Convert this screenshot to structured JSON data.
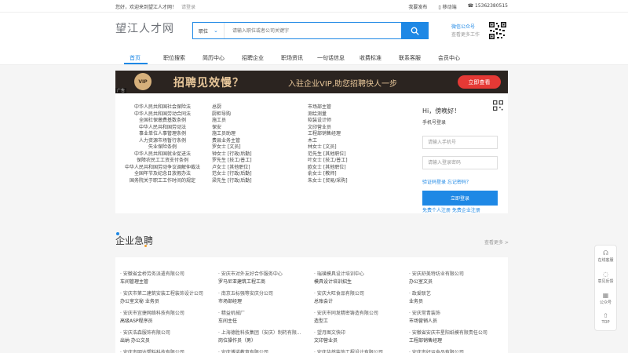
{
  "topbar": {
    "greeting": "您好，欢迎来到望江人才网！",
    "login": "请登录",
    "post_job": "我要发布",
    "mobile": "移动端",
    "phone": "15362380515"
  },
  "header": {
    "logo": "望江人才网",
    "search_category": "职位",
    "search_placeholder": "请输入职位或者公司关键字",
    "wechat_title": "微信公众号",
    "wechat_sub": "查看更多工作"
  },
  "nav": [
    "首页",
    "职位搜索",
    "简历中心",
    "招聘企业",
    "职场资讯",
    "一句话信息",
    "收费标准",
    "联系客服",
    "会员中心"
  ],
  "banner": {
    "vip": "VIP",
    "headline": "招聘见效慢？",
    "sub": "入驻企业VIP,助您招聘快人一步",
    "cta": "立即查看",
    "ad": "广告"
  },
  "links": {
    "col1": [
      "中华人民共和国社会保险法",
      "中华人民共和国劳动合同法",
      "全国社保缴费基数条例",
      "中华人民共和国劳动法",
      "事业单位人事管理条例",
      "人力资源市场暂行条例",
      "失业保险条例",
      "中华人民共和国就业促进法",
      "保障农民工工资支付条例",
      "中华人民共和国劳动争议调解仲裁法",
      "全国年节及纪念日放假办法",
      "国务院关于职工工作时间的规定"
    ],
    "col2": [
      "总厨",
      "厨柜导购",
      "施工员",
      "保安",
      "施工员助理",
      "费县业务主管",
      "罗女士 [文员]",
      "钟女士 [行政/后勤]",
      "罗先生 [技工/普工]",
      "卢女士 [其他职位]",
      "范女士 [行政/后勤]",
      "梁先生 [行政/后勤]"
    ],
    "col3": [
      "市场部主管",
      "测绘测量",
      "软装设计师",
      "文印营业员",
      "工程部销售经理",
      "木工",
      "林女士 [文员]",
      "范先生 [其他职位]",
      "叶女士 [技工/普工]",
      "欧女士 [其他职位]",
      "俞女士 [教师]",
      "朱女士 [贸易/采购]"
    ]
  },
  "login": {
    "greeting": "Hi，傍晚好！",
    "tab": "手机号登录",
    "phone_placeholder": "请输入手机号",
    "password_placeholder": "请输入登录密码",
    "alt_links": "验证码登录 忘记密码？",
    "submit": "立即登录",
    "register": "免费个人注册 免费企业注册"
  },
  "section": {
    "title": "企业急聘",
    "more": "查看更多 >"
  },
  "jobs": [
    {
      "company": "· 安徽省金桥劳务派遣有限公司",
      "position": "车间管理主管"
    },
    {
      "company": "· 安庆市对外友好合作服务中心",
      "position": "罗马尼亚建筑工程工商"
    },
    {
      "company": "· 瑞璞模具设计培训中心",
      "position": "模具设计培训招生"
    },
    {
      "company": "· 安庆舒美特纺业有限公司",
      "position": "办公室文员"
    },
    {
      "company": "· 安庆市第二建筑安装工程装饰设计公司",
      "position": "办公室文秘 业务员"
    },
    {
      "company": "· 南京五标强等安庆分公司",
      "position": "市场部经理"
    },
    {
      "company": "· 安庆大旺食品有限公司",
      "position": "总账会计"
    },
    {
      "company": "· 政爱联艺",
      "position": "业务员"
    },
    {
      "company": "· 安庆市宜捷网络科技有限公司",
      "position": "高级ASP程序员"
    },
    {
      "company": "· 精益机械厂",
      "position": "车间主任"
    },
    {
      "company": "· 安庆市同发精密铸造有限公司",
      "position": "造型工"
    },
    {
      "company": "· 安庆常青装饰",
      "position": "市场营销人员"
    },
    {
      "company": "· 安庆浩森服饰有限公司",
      "position": "出纳 办公文员"
    },
    {
      "company": "· 上海德胜科技集团（安庆）制药有限...",
      "position": "岗位操作员（男）"
    },
    {
      "company": "· 望月图文快印",
      "position": "文印营业员"
    },
    {
      "company": "· 安徽省安庆市星阳纸模有限责任公司",
      "position": "工程部销售经理"
    },
    {
      "company": "· 安庆市明达塑料科技有限公司",
      "position": ""
    },
    {
      "company": "· 安庆博诺教育有限公司",
      "position": ""
    },
    {
      "company": "· 安庆华然装饰工程设计有限公司",
      "position": ""
    },
    {
      "company": "· 安庆市好运食品有限公司",
      "position": ""
    }
  ],
  "sidebar": [
    "在线客服",
    "意见反馈",
    "公众号",
    "TOP"
  ],
  "colors": {
    "accent": "#1e88e5",
    "banner_bg": "#2b2420",
    "banner_cta": "#e53935"
  }
}
